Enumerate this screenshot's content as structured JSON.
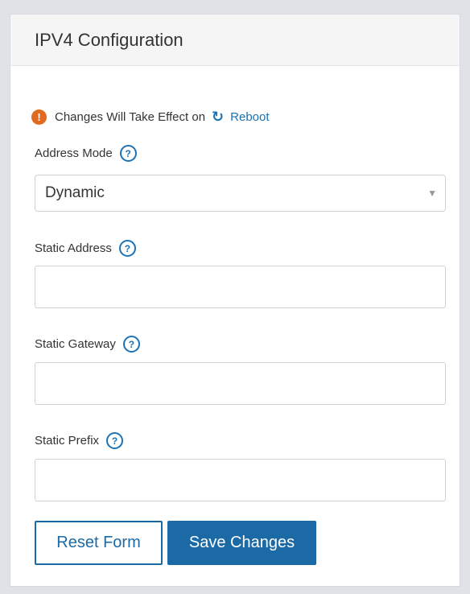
{
  "panel": {
    "title": "IPV4 Configuration"
  },
  "notice": {
    "text": "Changes Will Take Effect on",
    "link_label": "Reboot",
    "warning_icon": "!",
    "reboot_icon": "↻"
  },
  "fields": {
    "address_mode": {
      "label": "Address Mode",
      "help": "?",
      "value": "Dynamic"
    },
    "static_address": {
      "label": "Static Address",
      "help": "?",
      "value": ""
    },
    "static_gateway": {
      "label": "Static Gateway",
      "help": "?",
      "value": ""
    },
    "static_prefix": {
      "label": "Static Prefix",
      "help": "?",
      "value": ""
    }
  },
  "buttons": {
    "reset_label": "Reset Form",
    "save_label": "Save Changes"
  },
  "colors": {
    "accent": "#1b6aa6",
    "warning": "#e06a1e"
  }
}
